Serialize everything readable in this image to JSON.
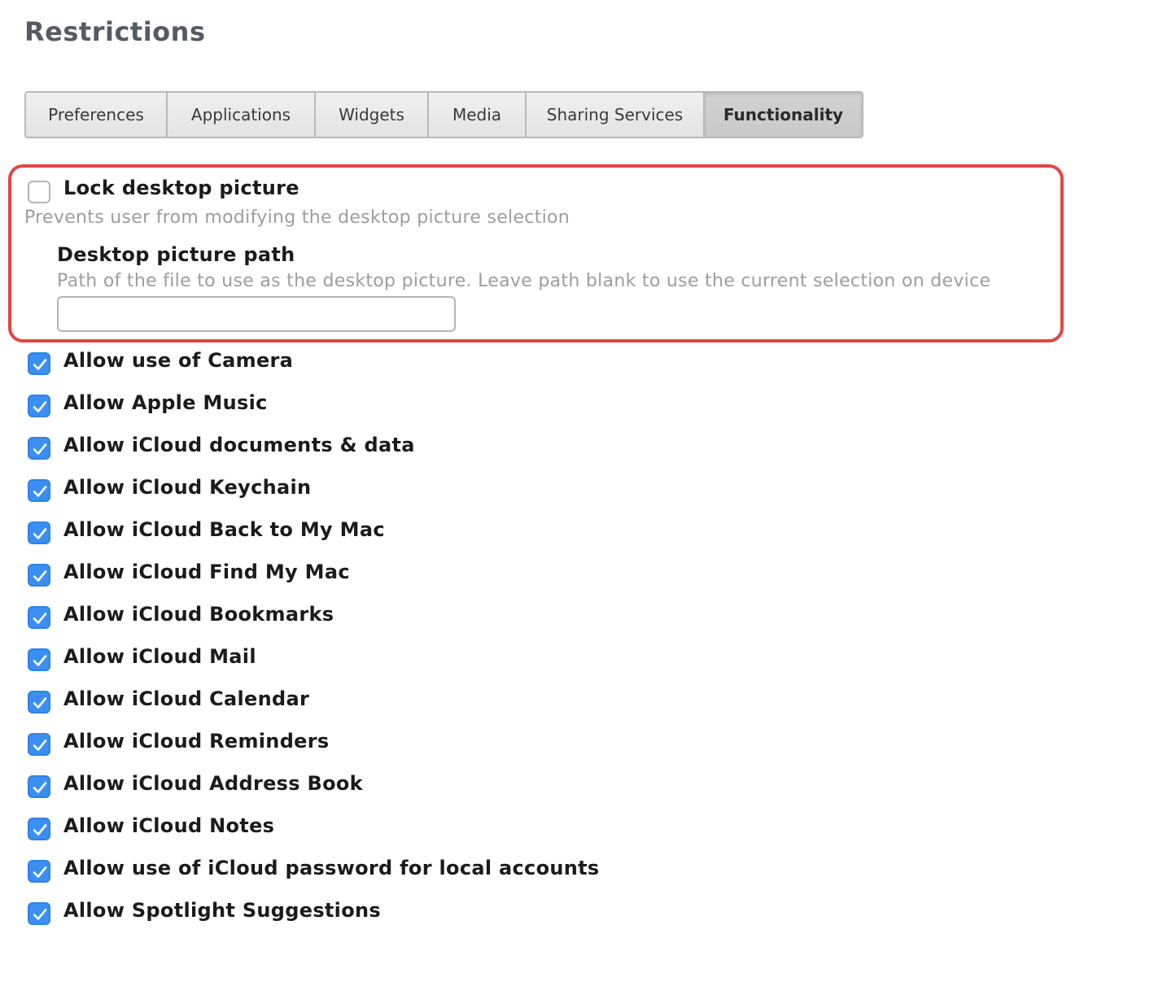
{
  "page_title": "Restrictions",
  "tabs": [
    {
      "label": "Preferences",
      "active": false
    },
    {
      "label": "Applications",
      "active": false
    },
    {
      "label": "Widgets",
      "active": false
    },
    {
      "label": "Media",
      "active": false
    },
    {
      "label": "Sharing Services",
      "active": false
    },
    {
      "label": "Functionality",
      "active": true
    }
  ],
  "lock_desktop": {
    "label": "Lock desktop picture",
    "checked": false,
    "description": "Prevents user from modifying the desktop picture selection"
  },
  "desktop_path": {
    "label": "Desktop picture path",
    "description": "Path of the file to use as the desktop picture. Leave path blank to use the current selection on device",
    "value": "",
    "placeholder": ""
  },
  "options": [
    {
      "label": "Allow use of Camera",
      "checked": true
    },
    {
      "label": "Allow Apple Music",
      "checked": true
    },
    {
      "label": "Allow iCloud documents & data",
      "checked": true
    },
    {
      "label": "Allow iCloud Keychain",
      "checked": true
    },
    {
      "label": "Allow iCloud Back to My Mac",
      "checked": true
    },
    {
      "label": "Allow iCloud Find My Mac",
      "checked": true
    },
    {
      "label": "Allow iCloud Bookmarks",
      "checked": true
    },
    {
      "label": "Allow iCloud Mail",
      "checked": true
    },
    {
      "label": "Allow iCloud Calendar",
      "checked": true
    },
    {
      "label": "Allow iCloud Reminders",
      "checked": true
    },
    {
      "label": "Allow iCloud Address Book",
      "checked": true
    },
    {
      "label": "Allow iCloud Notes",
      "checked": true
    },
    {
      "label": "Allow use of iCloud password for local accounts",
      "checked": true
    },
    {
      "label": "Allow Spotlight Suggestions",
      "checked": true
    }
  ],
  "colors": {
    "accent": "#3b8ff3",
    "highlight": "#e34543",
    "title": "#555b61",
    "description": "#9d9d9d"
  },
  "icons": {
    "checkmark": "checkmark-icon"
  }
}
